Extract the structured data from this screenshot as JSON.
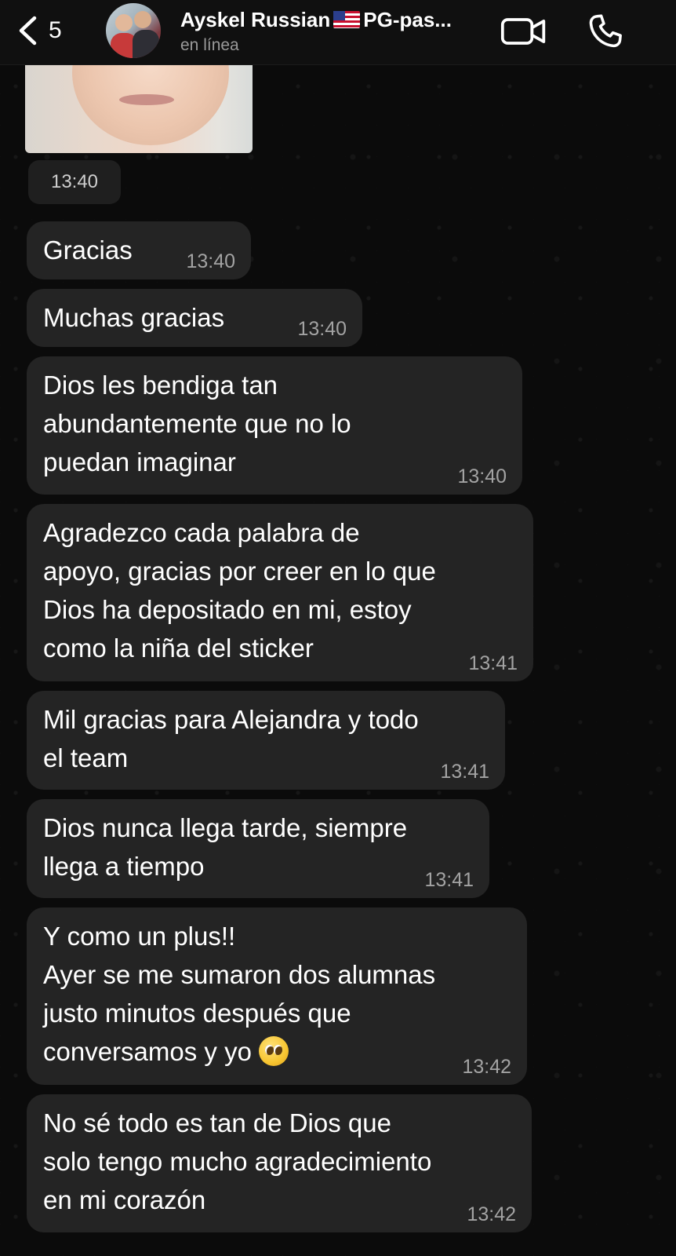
{
  "header": {
    "back_count": "5",
    "title": "Ayskel Russian",
    "title_suffix": "PG-pas...",
    "status": "en línea",
    "flag_icon": "us-flag-icon"
  },
  "photo": {
    "time": "13:40"
  },
  "messages": [
    {
      "lines": [
        "Gracias"
      ],
      "time": "13:40"
    },
    {
      "lines": [
        "Muchas gracias"
      ],
      "time": "13:40"
    },
    {
      "lines": [
        "Dios les bendiga tan",
        "abundantemente que no lo",
        "puedan imaginar"
      ],
      "time": "13:40"
    },
    {
      "lines": [
        "Agradezco cada palabra de",
        "apoyo, gracias por creer en lo que",
        "Dios ha depositado en mi, estoy",
        "como la niña del sticker"
      ],
      "time": "13:41"
    },
    {
      "lines": [
        "Mil gracias para Alejandra y todo",
        "el team"
      ],
      "time": "13:41"
    },
    {
      "lines": [
        "Dios nunca llega tarde, siempre",
        "llega a tiempo"
      ],
      "time": "13:41"
    },
    {
      "lines": [
        "Y como un plus!!",
        "Ayer se me sumaron dos alumnas",
        "justo minutos después que",
        "conversamos y yo"
      ],
      "emoji": "pleading-face-emoji",
      "time": "13:42"
    },
    {
      "lines": [
        "No sé todo es tan de Dios que",
        "solo tengo mucho agradecimiento",
        "en mi corazón"
      ],
      "time": "13:42"
    }
  ],
  "colors": {
    "background": "#0b0b0b",
    "bubble": "#242424",
    "timestamp": "#a3a3a3",
    "status": "#9a9a9a"
  }
}
